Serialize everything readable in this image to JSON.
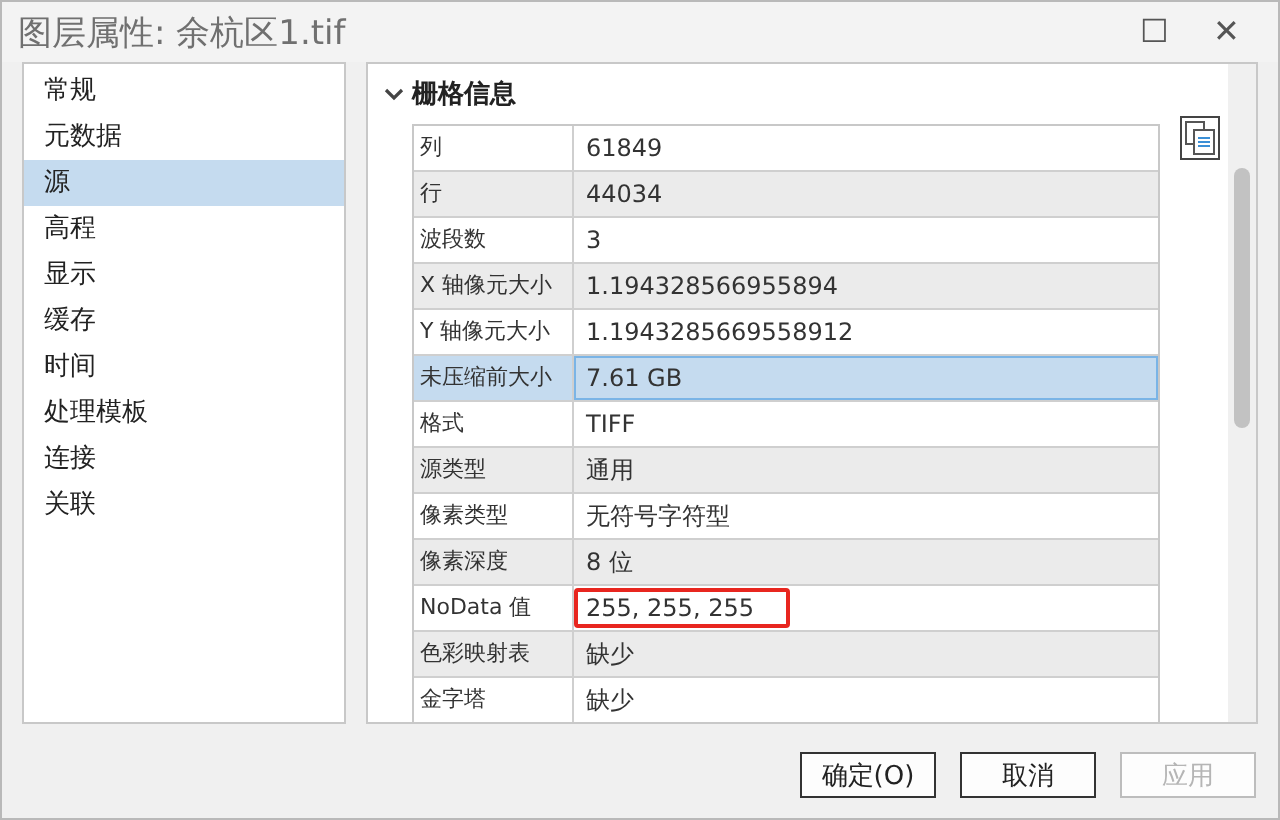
{
  "window": {
    "title": "图层属性: 余杭区1.tif",
    "maximize_glyph": "☐",
    "close_glyph": "✕"
  },
  "sidebar": {
    "items": [
      {
        "label": "常规",
        "selected": false
      },
      {
        "label": "元数据",
        "selected": false
      },
      {
        "label": "源",
        "selected": true
      },
      {
        "label": "高程",
        "selected": false
      },
      {
        "label": "显示",
        "selected": false
      },
      {
        "label": "缓存",
        "selected": false
      },
      {
        "label": "时间",
        "selected": false
      },
      {
        "label": "处理模板",
        "selected": false
      },
      {
        "label": "连接",
        "selected": false
      },
      {
        "label": "关联",
        "selected": false
      }
    ]
  },
  "section": {
    "title": "栅格信息",
    "expanded": true,
    "rows": [
      {
        "name": "列",
        "value": "61849",
        "selected": false,
        "highlighted": false
      },
      {
        "name": "行",
        "value": "44034",
        "selected": false,
        "highlighted": false
      },
      {
        "name": "波段数",
        "value": "3",
        "selected": false,
        "highlighted": false
      },
      {
        "name": "X 轴像元大小",
        "value": "1.194328566955894",
        "selected": false,
        "highlighted": false
      },
      {
        "name": "Y 轴像元大小",
        "value": "1.1943285669558912",
        "selected": false,
        "highlighted": false
      },
      {
        "name": "未压缩前大小",
        "value": "7.61 GB",
        "selected": true,
        "highlighted": false
      },
      {
        "name": "格式",
        "value": "TIFF",
        "selected": false,
        "highlighted": false
      },
      {
        "name": "源类型",
        "value": "通用",
        "selected": false,
        "highlighted": false
      },
      {
        "name": "像素类型",
        "value": "无符号字符型",
        "selected": false,
        "highlighted": false
      },
      {
        "name": "像素深度",
        "value": "8 位",
        "selected": false,
        "highlighted": false
      },
      {
        "name": "NoData 值",
        "value": "255, 255, 255",
        "selected": false,
        "highlighted": true
      },
      {
        "name": "色彩映射表",
        "value": "缺少",
        "selected": false,
        "highlighted": false
      },
      {
        "name": "金字塔",
        "value": "缺少",
        "selected": false,
        "highlighted": false
      }
    ]
  },
  "buttons": [
    {
      "label": "确定(O)",
      "disabled": false
    },
    {
      "label": "取消",
      "disabled": false
    },
    {
      "label": "应用",
      "disabled": true
    }
  ]
}
